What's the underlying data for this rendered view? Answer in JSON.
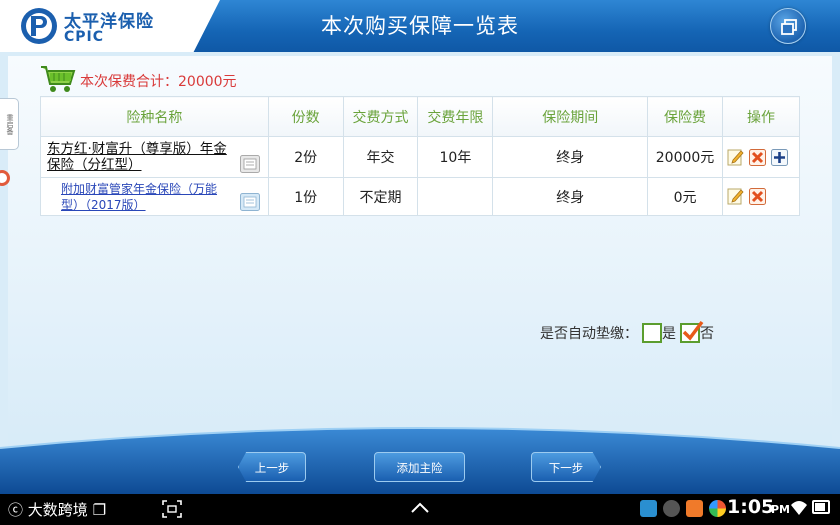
{
  "header": {
    "logo_cn": "太平洋保险",
    "logo_en": "CPIC",
    "title": "本次购买保障一览表",
    "window_button_icon": "window-restore-icon",
    "brand_color": "#1565b5"
  },
  "side": {
    "tab_label": "重启备"
  },
  "summary": {
    "total_label": "本次保费合计：20000元",
    "cart_icon": "shopping-cart-icon"
  },
  "table": {
    "headers": [
      "险种名称",
      "份数",
      "交费方式",
      "交费年限",
      "保险期间",
      "保险费",
      "操作"
    ],
    "rows": [
      {
        "name": "东方红·财富升（尊享版）年金保险（分红型）",
        "units": "2份",
        "pay_mode": "年交",
        "pay_years": "10年",
        "term": "终身",
        "premium": "20000元"
      },
      {
        "name": "附加财富管家年金保险（万能型）（2017版）",
        "units": "1份",
        "pay_mode": "不定期",
        "pay_years": "",
        "term": "终身",
        "premium": "0元"
      }
    ]
  },
  "auto_pay": {
    "label": "是否自动垫缴：",
    "yes": "是",
    "no": "否",
    "selected": "否"
  },
  "nav": {
    "prev": "上一步",
    "add_main": "添加主险",
    "next": "下一步"
  },
  "statusbar": {
    "left_text": "大数跨境",
    "time": "1:05",
    "ampm": "PM"
  }
}
